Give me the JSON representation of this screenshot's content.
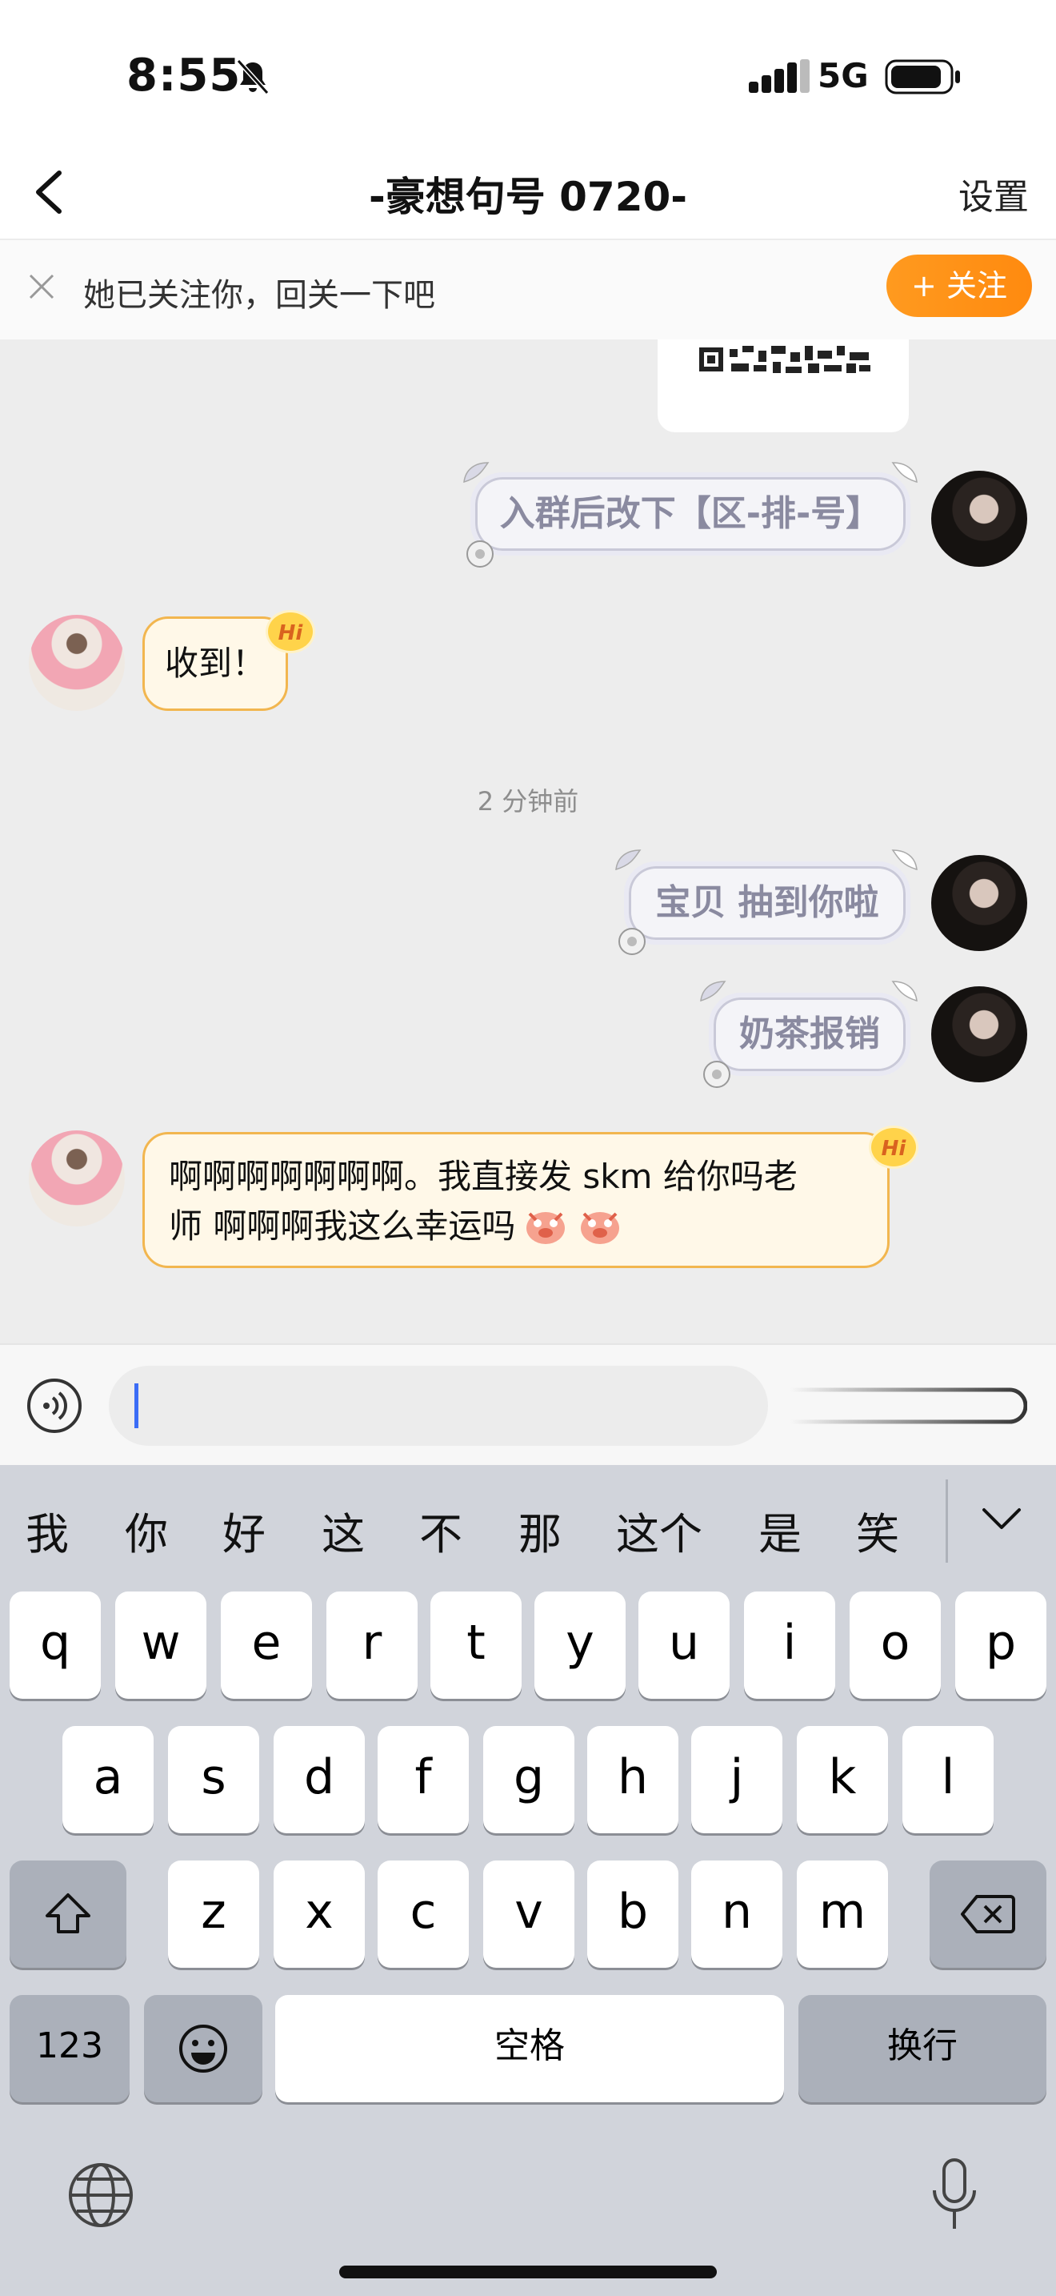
{
  "status_bar": {
    "time": "8:55",
    "network": "5G"
  },
  "nav": {
    "title": "-豪想句号 0720-",
    "settings": "设置"
  },
  "banner": {
    "text": "她已关注你，回关一下吧",
    "follow_label": "+ 关注"
  },
  "messages": {
    "m1": "入群后改下【区-排-号】",
    "m2": "收到！",
    "timestamp": "2 分钟前",
    "m3": "宝贝 抽到你啦",
    "m4": "奶茶报销",
    "m5_line1": "啊啊啊啊啊啊啊。我直接发 skm 给你吗老",
    "m5_line2": "师 啊啊啊我这么幸运吗",
    "hi": "Hi"
  },
  "keyboard": {
    "candidates": [
      "我",
      "你",
      "好",
      "这",
      "不",
      "那",
      "这个",
      "是",
      "笑"
    ],
    "row1": [
      "q",
      "w",
      "e",
      "r",
      "t",
      "y",
      "u",
      "i",
      "o",
      "p"
    ],
    "row2": [
      "a",
      "s",
      "d",
      "f",
      "g",
      "h",
      "j",
      "k",
      "l"
    ],
    "row3": [
      "z",
      "x",
      "c",
      "v",
      "b",
      "n",
      "m"
    ],
    "numbers_key": "123",
    "space_key": "空格",
    "return_key": "换行"
  },
  "colors": {
    "accent_orange": "#ff8f16",
    "chat_bg": "#ededed",
    "keyboard_bg": "#d1d4db"
  }
}
